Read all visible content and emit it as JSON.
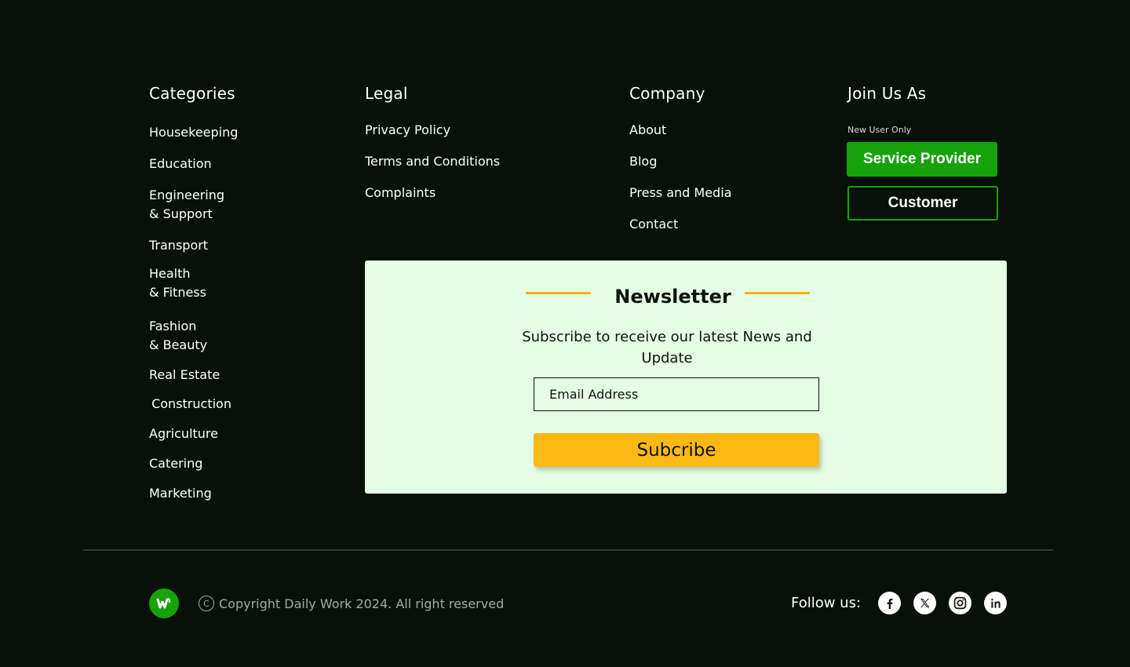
{
  "categories": {
    "title": "Categories",
    "items": [
      "Housekeeping",
      "Education",
      "Engineering\n & Support",
      "Transport",
      "Health\n& Fitness",
      "Fashion\n& Beauty",
      "Real Estate",
      " Construction",
      "Agriculture",
      "Catering",
      "Marketing"
    ]
  },
  "legal": {
    "title": "Legal",
    "items": [
      "Privacy Policy",
      "Terms and Conditions",
      "Complaints"
    ]
  },
  "company": {
    "title": "Company",
    "items": [
      "About",
      "Blog",
      "Press and Media",
      "Contact"
    ]
  },
  "join": {
    "title": "Join Us As",
    "note": "New User Only",
    "provider_label": "Service Provider",
    "customer_label": "Customer"
  },
  "newsletter": {
    "title": "Newsletter",
    "description": "Subscribe to  receive our latest News and Update",
    "email_placeholder": "Email Address",
    "button_label": "Subcribe"
  },
  "footer": {
    "copyright_symbol": "C",
    "copyright": "Copyright Daily Work 2024. All right reserved",
    "follow_label": "Follow us:",
    "socials": [
      "facebook-icon",
      "x-icon",
      "instagram-icon",
      "linkedin-icon"
    ]
  },
  "colors": {
    "background": "#07110a",
    "brand_green": "#15a20b",
    "accent_yellow": "#fdb913",
    "newsletter_bg": "#e4fde4"
  }
}
